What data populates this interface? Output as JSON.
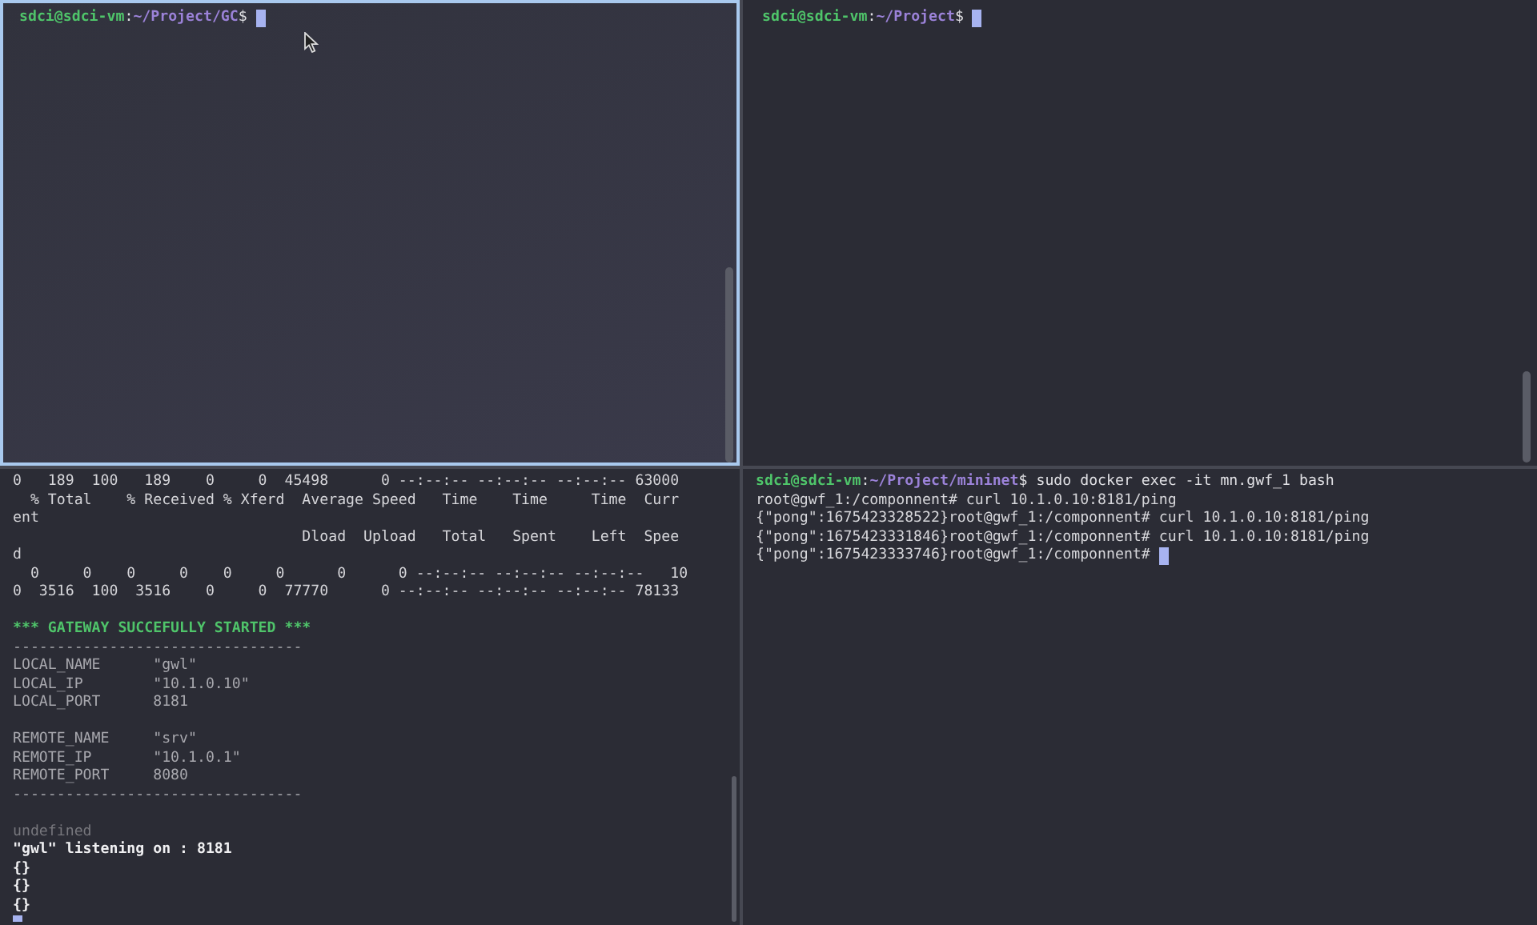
{
  "panes": [
    {
      "focused": true,
      "lines": [
        {
          "kind": "prompt",
          "user_host": "sdci@sdci-vm",
          "separator": ":",
          "path": "~/Project/GC",
          "sign": "$",
          "cursor": true
        }
      ]
    },
    {
      "focused": false,
      "lines": [
        {
          "kind": "prompt",
          "user_host": "sdci@sdci-vm",
          "separator": ":",
          "path": "~/Project",
          "sign": "$",
          "cursor": true
        }
      ]
    },
    {
      "focused": false,
      "lines": [
        {
          "kind": "output",
          "text": "0   189  100   189    0     0  45498      0 --:--:-- --:--:-- --:--:-- 63000",
          "cursor": false
        },
        {
          "kind": "output",
          "text": "  % Total    % Received % Xferd  Average Speed   Time    Time     Time  Curr",
          "cursor": false
        },
        {
          "kind": "output",
          "text": "ent",
          "cursor": false
        },
        {
          "kind": "output",
          "text": "                                 Dload  Upload   Total   Spent    Left  Spee",
          "cursor": false
        },
        {
          "kind": "output",
          "text": "d",
          "cursor": false
        },
        {
          "kind": "output",
          "text": "  0     0    0     0    0     0      0      0 --:--:-- --:--:-- --:--:--   10",
          "cursor": false
        },
        {
          "kind": "output",
          "text": "0  3516  100  3516    0     0  77770      0 --:--:-- --:--:-- --:--:-- 78133",
          "cursor": false
        },
        {
          "kind": "blank",
          "cursor": false
        },
        {
          "kind": "heading",
          "text": "*** GATEWAY SUCCEFULLY STARTED ***",
          "cursor": false
        },
        {
          "kind": "muted",
          "text": "---------------------------------",
          "cursor": false
        },
        {
          "kind": "muted",
          "text": "LOCAL_NAME      \"gwl\"",
          "cursor": false
        },
        {
          "kind": "muted",
          "text": "LOCAL_IP        \"10.1.0.10\"",
          "cursor": false
        },
        {
          "kind": "muted",
          "text": "LOCAL_PORT      8181",
          "cursor": false
        },
        {
          "kind": "blank",
          "cursor": false
        },
        {
          "kind": "muted",
          "text": "REMOTE_NAME     \"srv\"",
          "cursor": false
        },
        {
          "kind": "muted",
          "text": "REMOTE_IP       \"10.1.0.1\"",
          "cursor": false
        },
        {
          "kind": "muted",
          "text": "REMOTE_PORT     8080",
          "cursor": false
        },
        {
          "kind": "muted",
          "text": "---------------------------------",
          "cursor": false
        },
        {
          "kind": "blank",
          "cursor": false
        },
        {
          "kind": "faint",
          "text": "undefined",
          "cursor": false
        },
        {
          "kind": "bold",
          "text": "\"gwl\" listening on : 8181",
          "cursor": false
        },
        {
          "kind": "bold",
          "text": "{}",
          "cursor": false
        },
        {
          "kind": "bold",
          "text": "{}",
          "cursor": false
        },
        {
          "kind": "bold",
          "text": "{}",
          "cursor": false
        },
        {
          "kind": "blank",
          "cursor": true
        }
      ]
    },
    {
      "focused": false,
      "lines": [
        {
          "kind": "prompt",
          "user_host": "sdci@sdci-vm",
          "separator": ":",
          "path": "~/Project/mininet",
          "sign": "$",
          "command": " sudo docker exec -it mn.gwf_1 bash",
          "cursor": false
        },
        {
          "kind": "output",
          "text": "root@gwf_1:/componnent# curl 10.1.0.10:8181/ping",
          "cursor": false
        },
        {
          "kind": "output",
          "text": "{\"pong\":1675423328522}root@gwf_1:/componnent# curl 10.1.0.10:8181/ping",
          "cursor": false
        },
        {
          "kind": "output",
          "text": "{\"pong\":1675423331846}root@gwf_1:/componnent# curl 10.1.0.10:8181/ping",
          "cursor": false
        },
        {
          "kind": "output",
          "text": "{\"pong\":1675423333746}root@gwf_1:/componnent# ",
          "cursor": true
        }
      ]
    }
  ]
}
